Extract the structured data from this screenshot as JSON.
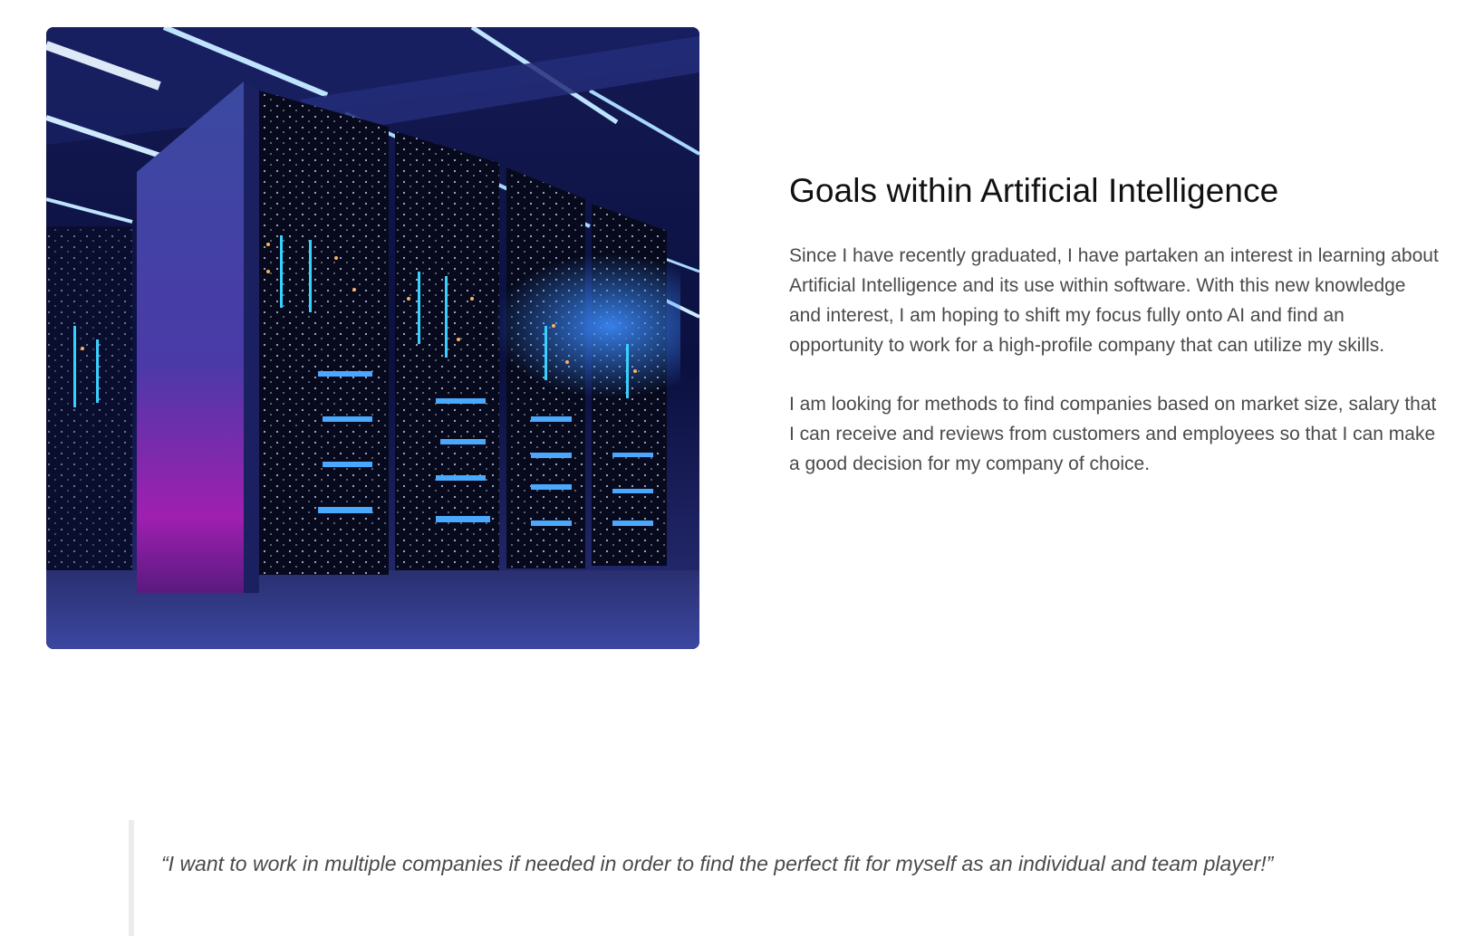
{
  "hero_image": {
    "alt": "server room image"
  },
  "section": {
    "title": "Goals within Artificial Intelligence",
    "paragraphs": [
      "Since I have recently graduated, I have partaken an interest in learning about Artificial Intelligence and its use within software. With this new knowledge and interest, I am hoping to shift my focus fully onto AI and find an opportunity to work for a high-profile company that can utilize my skills.",
      "I am looking for methods to find companies based on market size, salary that I can receive and reviews from customers and employees so that I can make a good decision for my company of choice."
    ]
  },
  "quote": {
    "text": "“I want to work in multiple companies if needed in order to find the perfect fit for myself as an individual and team player!”"
  },
  "colors": {
    "heading": "#111111",
    "body_text": "#4a4a4a",
    "quote_border": "#ececec",
    "image_base": "#0a0f3a",
    "accent_blue": "#3c8cff",
    "accent_magenta": "#a01fb0"
  }
}
